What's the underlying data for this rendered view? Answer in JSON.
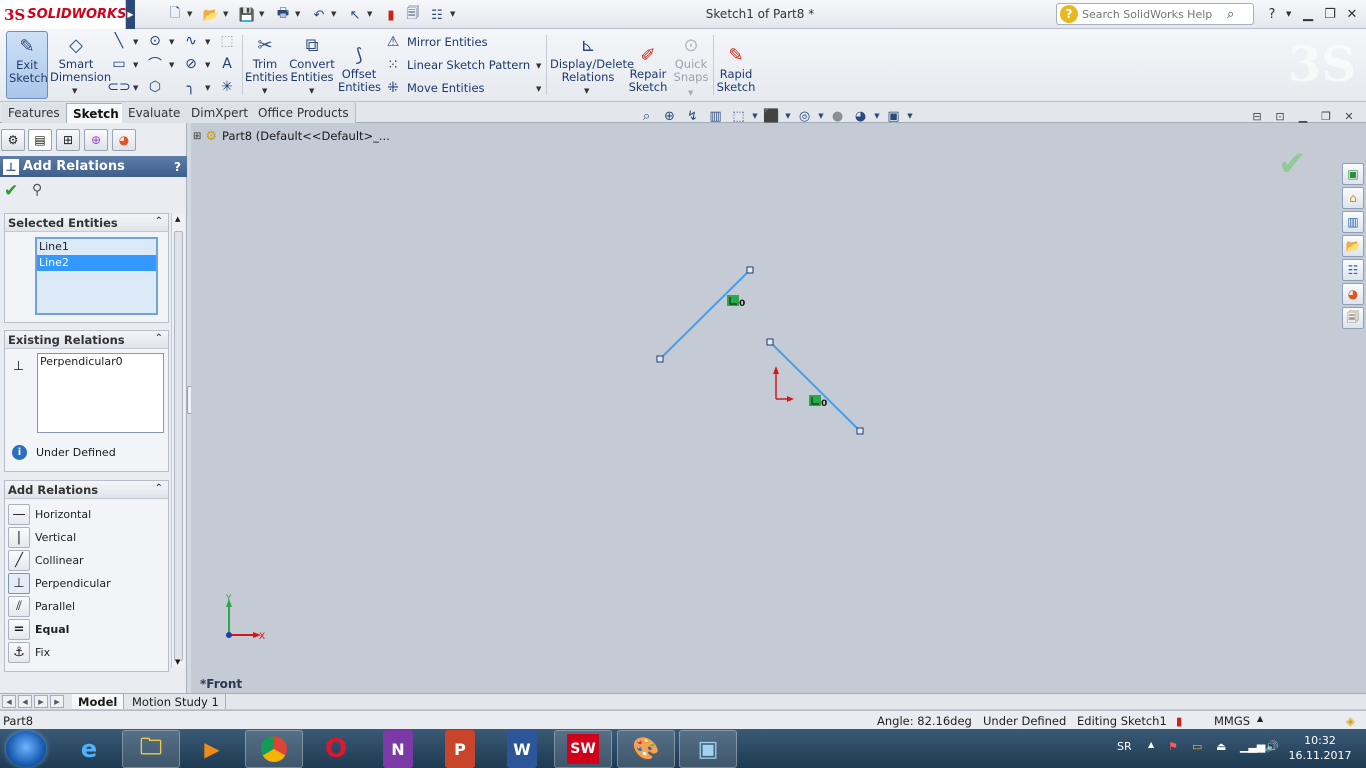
{
  "app": {
    "logo_ds": "3S",
    "logo_name": "SOLIDWORKS",
    "window_title": "Sketch1 of Part8 *"
  },
  "search": {
    "placeholder": "Search SolidWorks Help"
  },
  "ribbon": {
    "exit_sketch": "Exit Sketch",
    "smart_dimension": "Smart Dimension",
    "trim_entities": "Trim Entities",
    "convert_entities": "Convert Entities",
    "offset_entities": "Offset Entities",
    "mirror_entities": "Mirror Entities",
    "linear_sketch_pattern": "Linear Sketch Pattern",
    "move_entities": "Move Entities",
    "display_delete_relations": "Display/Delete Relations",
    "repair_sketch": "Repair Sketch",
    "quick_snaps": "Quick Snaps",
    "rapid_sketch": "Rapid Sketch"
  },
  "tabs": [
    "Features",
    "Sketch",
    "Evaluate",
    "DimXpert",
    "Office Products"
  ],
  "property_manager": {
    "title": "Add Relations",
    "help": "?",
    "selected_entities": {
      "label": "Selected Entities",
      "items": [
        "Line1",
        "Line2"
      ]
    },
    "existing_relations": {
      "label": "Existing Relations",
      "items": [
        "Perpendicular0"
      ],
      "status": "Under Defined"
    },
    "add_relations": {
      "label": "Add Relations",
      "items": [
        "Horizontal",
        "Vertical",
        "Collinear",
        "Perpendicular",
        "Parallel",
        "Equal",
        "Fix"
      ]
    }
  },
  "tree": {
    "part": "Part8  (Default<<Default>_..."
  },
  "viewport": {
    "view_label": "*Front",
    "axis_y": "Y",
    "axis_x": "X",
    "relation_glyph": "0"
  },
  "model_tabs": [
    "Model",
    "Motion Study 1"
  ],
  "status_bar": {
    "document": "Part8",
    "angle": "Angle: 82.16deg",
    "definition": "Under Defined",
    "editing": "Editing Sketch1",
    "units": "MMGS"
  },
  "taskbar": {
    "lang": "SR",
    "time": "10:32",
    "date": "16.11.2017"
  },
  "colors": {
    "sketch_line": "#4a9ee8",
    "endpoint": "#1f3d75",
    "relation_icon": "#2aa84a",
    "accent": "#3e5f8c"
  }
}
